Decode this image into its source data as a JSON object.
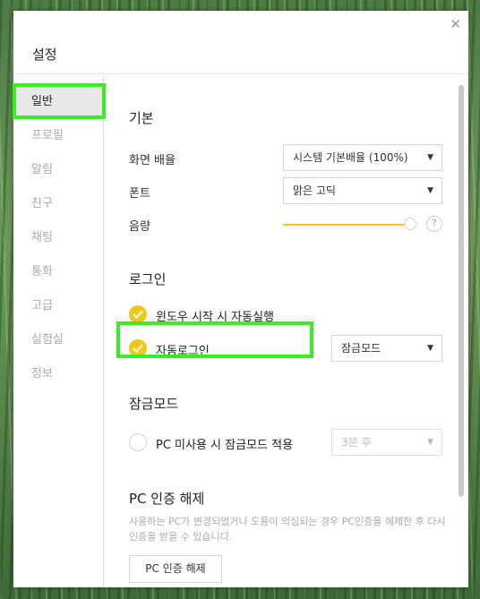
{
  "dialog": {
    "title": "설정",
    "close_glyph": "✕"
  },
  "sidebar": {
    "items": [
      {
        "label": "일반"
      },
      {
        "label": "프로필"
      },
      {
        "label": "알림"
      },
      {
        "label": "친구"
      },
      {
        "label": "채팅"
      },
      {
        "label": "통화"
      },
      {
        "label": "고급"
      },
      {
        "label": "실험실"
      },
      {
        "label": "정보"
      }
    ]
  },
  "basic": {
    "title": "기본",
    "zoom_label": "화면 배율",
    "zoom_value": "시스템 기본배율 (100%)",
    "font_label": "폰트",
    "font_value": "맑은 고딕",
    "volume_label": "음량",
    "volume_level": 1.0,
    "help_glyph": "?"
  },
  "login": {
    "title": "로그인",
    "autostart_label": "윈도우 시작 시 자동실행",
    "autostart_checked": true,
    "autologin_label": "자동로그인",
    "autologin_checked": true,
    "autologin_mode": "잠금모드"
  },
  "lockmode": {
    "title": "잠금모드",
    "idle_label": "PC 미사용 시 잠금모드 적용",
    "idle_checked": false,
    "idle_value": "3분 후"
  },
  "pc_auth": {
    "title": "PC 인증 해제",
    "description": "사용하는 PC가 변경되었거나 도용이 의심되는 경우 PC인증을 해제한 후 다시 인증을 받을 수 있습니다.",
    "button_label": "PC 인증 해제"
  },
  "colors": {
    "accent": "#f5c518",
    "highlight": "#37f020"
  }
}
